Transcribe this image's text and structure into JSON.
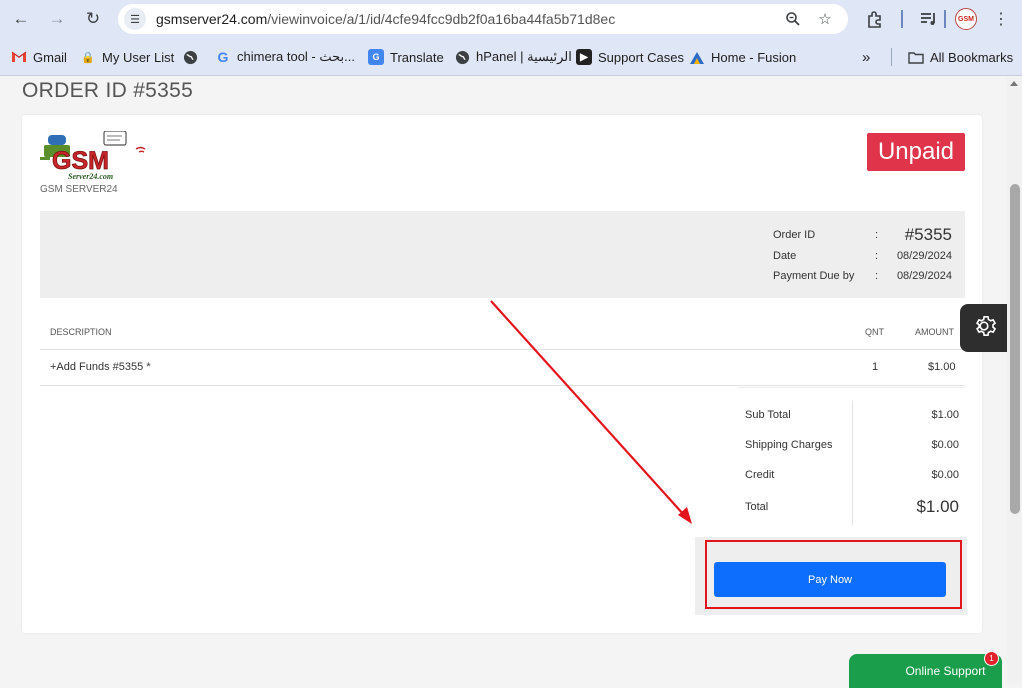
{
  "browser": {
    "url_host": "gsmserver24.com",
    "url_path": "/viewinvoice/a/1/id/4cfe94fcc9db2f0a16ba44fa5b71d8ec",
    "avatar_text": "GSM"
  },
  "bookmarks": [
    {
      "label": "Gmail",
      "icon": "gmail-icon"
    },
    {
      "label": "My User List",
      "icon": "lock-icon"
    },
    {
      "label": "",
      "icon": "globe-icon"
    },
    {
      "label": "chimera tool - بحث...",
      "icon": "google-icon"
    },
    {
      "label": "Translate",
      "icon": "translate-icon"
    },
    {
      "label": "hPanel | الرئيسية",
      "icon": "globe-icon"
    },
    {
      "label": "Support Cases",
      "icon": "support-icon"
    },
    {
      "label": "Home - Fusion",
      "icon": "fusion-icon"
    },
    {
      "label": "All Bookmarks",
      "icon": "folder-icon"
    }
  ],
  "page": {
    "heading": "ORDER ID #5355",
    "logo_sub": "GSM SERVER24",
    "logo_text": "GSM",
    "logo_small": "Server24.com",
    "status": "Unpaid"
  },
  "info": {
    "order_id_label": "Order ID",
    "order_id_value": "#5355",
    "date_label": "Date",
    "date_value": "08/29/2024",
    "due_label": "Payment Due by",
    "due_value": "08/29/2024",
    "colon": ":"
  },
  "table": {
    "headers": {
      "description": "DESCRIPTION",
      "qnt": "QNT",
      "amount": "AMOUNT"
    },
    "rows": [
      {
        "description": "+Add Funds #5355 *",
        "qnt": "1",
        "amount": "$1.00"
      }
    ]
  },
  "totals": {
    "subtotal_label": "Sub Total",
    "subtotal_value": "$1.00",
    "shipping_label": "Shipping Charges",
    "shipping_value": "$0.00",
    "credit_label": "Credit",
    "credit_value": "$0.00",
    "total_label": "Total",
    "total_value": "$1.00"
  },
  "actions": {
    "pay_now": "Pay Now",
    "online_support": "Online Support",
    "support_badge": "1"
  },
  "colors": {
    "unpaid": "#e0344a",
    "pay_button": "#0d6efd",
    "annotation": "#e3141b",
    "support": "#1b9e4b"
  }
}
